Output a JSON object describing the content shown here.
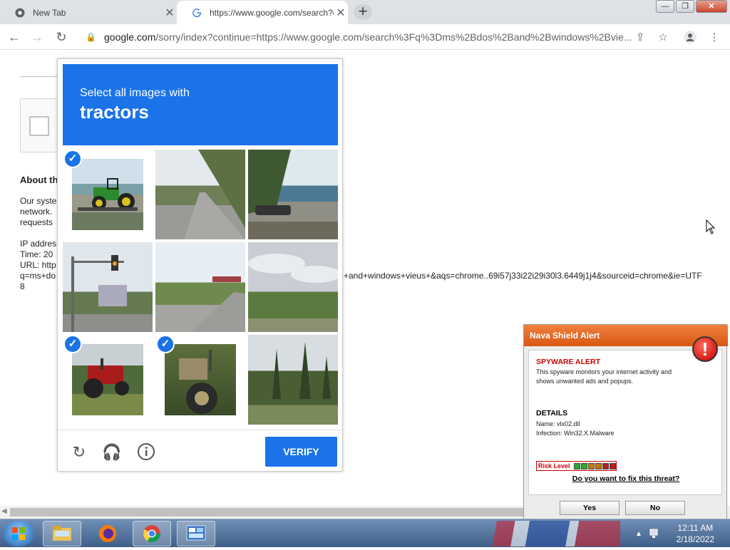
{
  "browser": {
    "tabs": [
      {
        "title": "New Tab",
        "close": "✕"
      },
      {
        "title": "https://www.google.com/search?q",
        "close": "✕"
      }
    ],
    "new_tab": "+",
    "address": {
      "host": "google.com",
      "path": "/sorry/index?continue=https://www.google.com/search%3Fq%3Dms%2Bdos%2Band%2Bwindows%2Bvie..."
    }
  },
  "page": {
    "heading": "About th",
    "para": [
      "Our syste",
      "network.",
      "requests"
    ],
    "info": [
      "IP addres",
      "Time: 20",
      "URL: http",
      "q=ms+do",
      "8"
    ],
    "url_tail": "+and+windows+vieus+&aqs=chrome..69i57j33i22i29i30l3.6449j1j4&sourceid=chrome&ie=UTF"
  },
  "captcha": {
    "instruction": "Select all images with",
    "target": "tractors",
    "verify_label": "VERIFY",
    "tiles": [
      {
        "name": "green tractor on trailer",
        "selected": true
      },
      {
        "name": "road with trees",
        "selected": false
      },
      {
        "name": "lake shore road",
        "selected": false
      },
      {
        "name": "traffic light",
        "selected": false
      },
      {
        "name": "road and field",
        "selected": false
      },
      {
        "name": "cloudy sky field",
        "selected": false
      },
      {
        "name": "red tractor",
        "selected": true
      },
      {
        "name": "tractor wheel",
        "selected": true
      },
      {
        "name": "cypress trees",
        "selected": false
      }
    ]
  },
  "alert": {
    "title": "Nava Shield Alert",
    "stop": "!",
    "heading": "SPYWARE ALERT",
    "desc": [
      "This spyware monitors your internet activity and",
      "shows unwanted ads and popups."
    ],
    "details_heading": "DETAILS",
    "name": "Name: vlx02.dll",
    "infection": "Infection: Win32.X.Malware",
    "risk_label": "Risk Level",
    "risk_colors": [
      "#2fa82f",
      "#2fa82f",
      "#c07a00",
      "#c07a00",
      "#b52020",
      "#b52020"
    ],
    "question": "Do you want to fix this threat?",
    "yes": "Yes",
    "no": "No"
  },
  "taskbar": {
    "time": "12:11 AM",
    "date": "2/18/2022"
  }
}
